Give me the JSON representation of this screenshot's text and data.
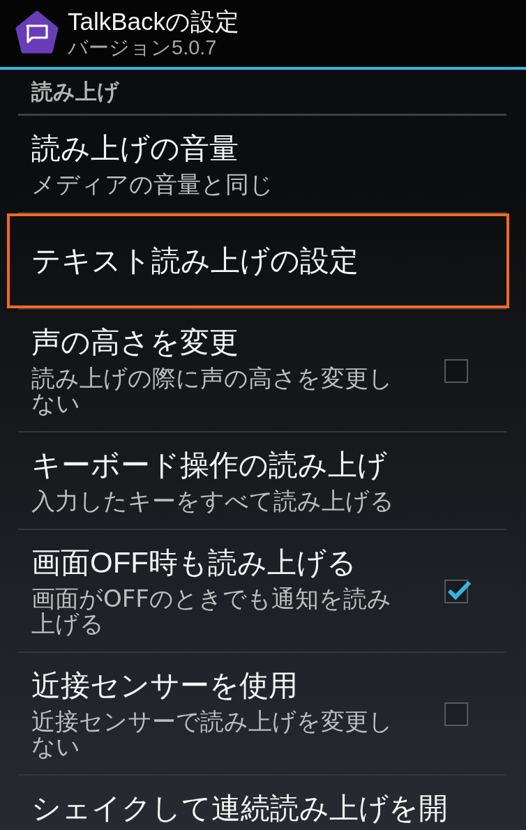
{
  "title_bar": {
    "title": "TalkBackの設定",
    "subtitle": "バージョン5.0.7"
  },
  "sections": [
    {
      "title": "読み上げ",
      "items": [
        {
          "kind": "text",
          "title": "読み上げの音量",
          "summary": "メディアの音量と同じ",
          "focused": false
        },
        {
          "kind": "text",
          "title": "テキスト読み上げの設定",
          "focused": true
        },
        {
          "kind": "checkbox",
          "title": "声の高さを変更",
          "summary": "読み上げの際に声の高さを変更しない",
          "checked": false,
          "focused": false
        },
        {
          "kind": "text",
          "title": "キーボード操作の読み上げ",
          "summary": "入力したキーをすべて読み上げる",
          "focused": false
        },
        {
          "kind": "checkbox",
          "title": "画面OFF時も読み上げる",
          "summary": "画面がOFFのときでも通知を読み上げる",
          "checked": true,
          "focused": false
        },
        {
          "kind": "checkbox",
          "title": "近接センサーを使用",
          "summary": "近接センサーで読み上げを変更しない",
          "checked": false,
          "focused": false
        },
        {
          "kind": "text",
          "title": "シェイクして連続読み上げを開",
          "focused": false
        }
      ]
    }
  ]
}
